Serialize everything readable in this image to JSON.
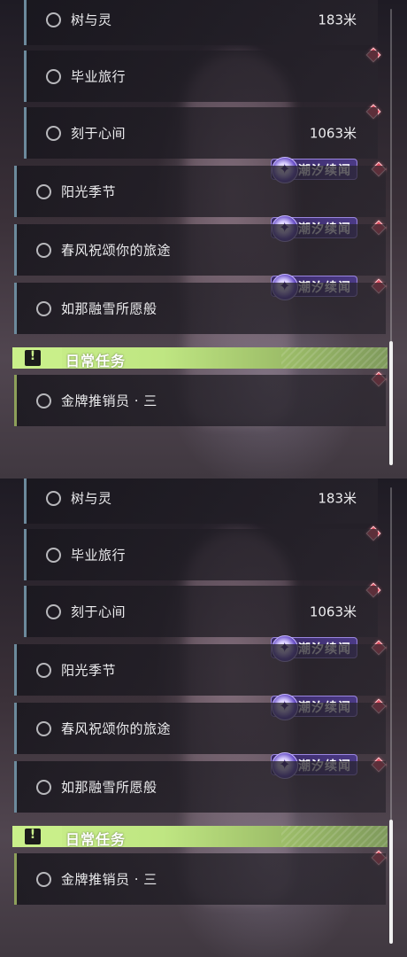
{
  "panels": [
    {
      "sub_quests": [
        {
          "name": "树与灵",
          "distance": "183米"
        },
        {
          "name": "毕业旅行",
          "distance": ""
        },
        {
          "name": "刻于心间",
          "distance": "1063米"
        }
      ],
      "tagged_quests": [
        {
          "name": "阳光季节",
          "tag": "潮汐续闻"
        },
        {
          "name": "春风祝颂你的旅途",
          "tag": "潮汐续闻"
        },
        {
          "name": "如那融雪所愿般",
          "tag": "潮汐续闻"
        }
      ],
      "daily_header": "日常任务",
      "daily_quests": [
        {
          "name": "金牌推销员 · 三"
        }
      ]
    },
    {
      "sub_quests": [
        {
          "name": "树与灵",
          "distance": "183米"
        },
        {
          "name": "毕业旅行",
          "distance": ""
        },
        {
          "name": "刻于心间",
          "distance": "1063米"
        }
      ],
      "tagged_quests": [
        {
          "name": "阳光季节",
          "tag": "潮汐续闻"
        },
        {
          "name": "春风祝颂你的旅途",
          "tag": "潮汐续闻"
        },
        {
          "name": "如那融雪所愿般",
          "tag": "潮汐续闻"
        }
      ],
      "daily_header": "日常任务",
      "daily_quests": [
        {
          "name": "金牌推销员 · 三"
        }
      ]
    }
  ],
  "colors": {
    "daily_accent": "#c9ef8a",
    "tag_purple": "#4b3a86",
    "marker_red": "#d94a5c"
  },
  "icons": {
    "quest_status": "circle-icon",
    "tag": "tide-sparkle-icon",
    "marker": "diamond-marker-icon",
    "daily": "exclamation-icon"
  }
}
